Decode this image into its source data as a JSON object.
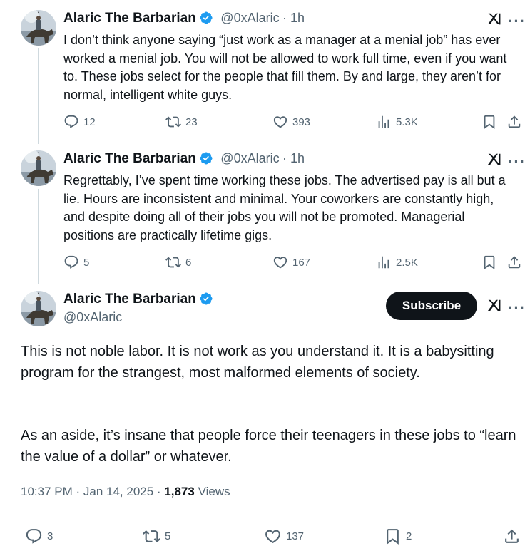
{
  "colors": {
    "text": "#0f1419",
    "muted": "#536471",
    "verified": "#1d9bf0",
    "line": "#cfd9de"
  },
  "tweets": [
    {
      "name": "Alaric The Barbarian",
      "handle": "@0xAlaric",
      "time": "· 1h",
      "text": "I don’t think anyone saying “just work as a manager at a menial job” has ever worked a menial job. You will not be allowed to work full time, even if you want to. These jobs select for the people that fill them. By and large, they aren’t for normal, intelligent white guys.",
      "replies": "12",
      "reposts": "23",
      "likes": "393",
      "views": "5.3K"
    },
    {
      "name": "Alaric The Barbarian",
      "handle": "@0xAlaric",
      "time": "· 1h",
      "text": "Regrettably, I’ve spent time working these jobs. The advertised pay is all but a lie. Hours are inconsistent and minimal. Your coworkers are constantly high, and despite doing all of their jobs you will not be promoted. Managerial positions are practically lifetime gigs.",
      "replies": "5",
      "reposts": "6",
      "likes": "167",
      "views": "2.5K"
    }
  ],
  "main": {
    "name": "Alaric The Barbarian",
    "handle": "@0xAlaric",
    "subscribe": "Subscribe",
    "paragraph1": "This is not noble labor. It is not work as you understand it. It is a babysitting program for the strangest, most malformed elements of society.",
    "paragraph2": "As an aside, it’s insane that people force their teenagers in these jobs to “learn the value of a dollar” or whatever.",
    "timestamp": "10:37 PM · Jan 14, 2025 · ",
    "views_count": "1,873",
    "views_label": " Views",
    "replies": "3",
    "reposts": "5",
    "likes": "137",
    "bookmarks": "2"
  }
}
